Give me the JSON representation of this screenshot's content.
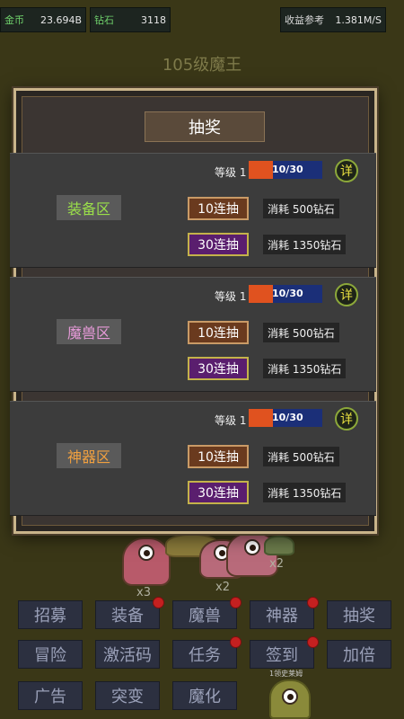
{
  "top_bar": {
    "gold_label": "金币",
    "gold_value": "23.694B",
    "diamond_label": "钻石",
    "diamond_value": "3118",
    "income_label": "收益参考",
    "income_value": "1.381M/S"
  },
  "stage_title": "105级魔王",
  "modal": {
    "title": "抽奖",
    "zones": [
      {
        "label": "装备区",
        "label_color": "#9be04a",
        "level_text": "等级 1",
        "progress_text": "10/30",
        "progress": 0.33,
        "detail": "详",
        "draw10_label": "10连抽",
        "draw10_cost": "消耗 500钻石",
        "draw30_label": "30连抽",
        "draw30_cost": "消耗 1350钻石"
      },
      {
        "label": "魔兽区",
        "label_color": "#e69ad8",
        "level_text": "等级 1",
        "progress_text": "10/30",
        "progress": 0.33,
        "detail": "详",
        "draw10_label": "10连抽",
        "draw10_cost": "消耗 500钻石",
        "draw30_label": "30连抽",
        "draw30_cost": "消耗 1350钻石"
      },
      {
        "label": "神器区",
        "label_color": "#f0a040",
        "level_text": "等级 1",
        "progress_text": "10/30",
        "progress": 0.33,
        "detail": "详",
        "draw10_label": "10连抽",
        "draw10_cost": "消耗 500钻石",
        "draw30_label": "30连抽",
        "draw30_cost": "消耗 1350钻石"
      }
    ]
  },
  "background": {
    "mult_left": "x3",
    "mult_mid": "x2",
    "mult_right": "x2"
  },
  "menu": {
    "recruit": "招募",
    "equipment": "装备",
    "beast": "魔兽",
    "artifact": "神器",
    "lottery": "抽奖",
    "adventure": "冒险",
    "activation_code": "激活码",
    "task": "任务",
    "sign_in": "签到",
    "double": "加倍",
    "ad": "广告",
    "mutation": "突变",
    "demonize": "魔化",
    "sign_note": "1领史莱姆"
  },
  "colors": {
    "bar_fill": "#e0521f",
    "bar_bg": "#1b2f78",
    "accent": "#c9b48a",
    "red_dot": "#c42020"
  }
}
